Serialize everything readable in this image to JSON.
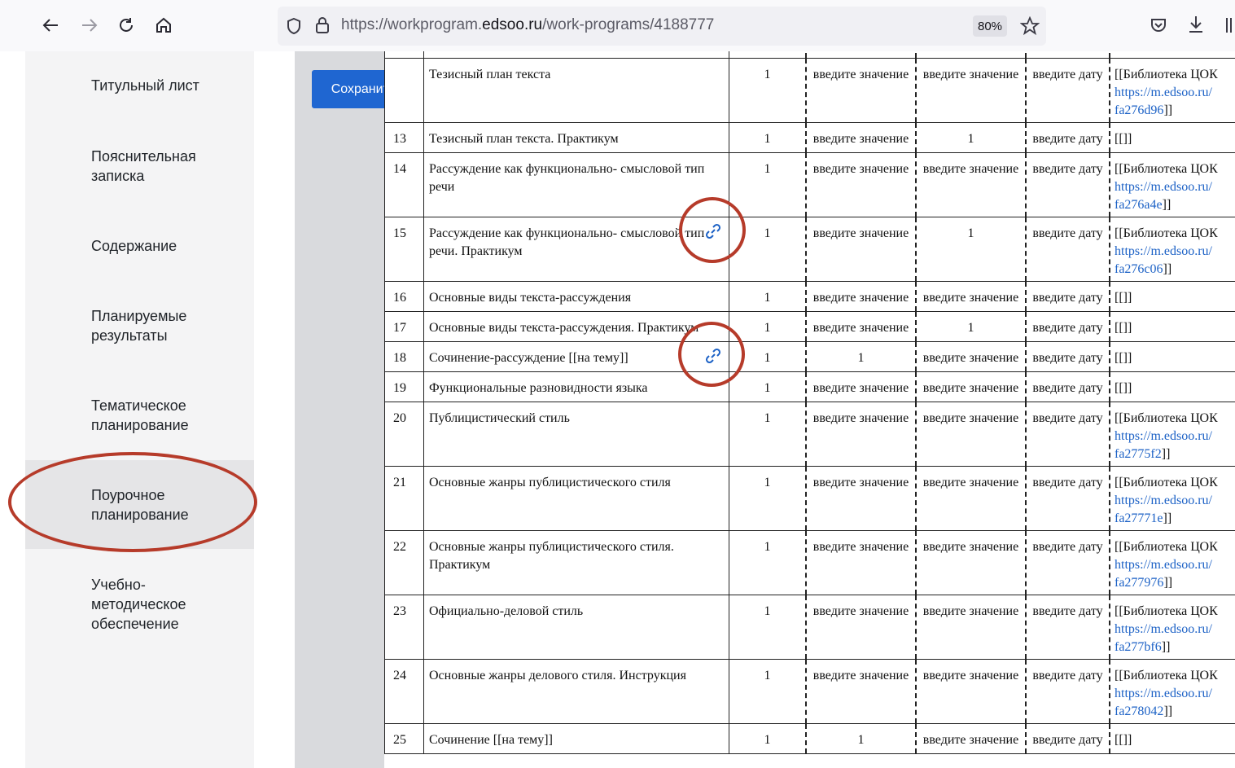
{
  "browser": {
    "url_prefix": "https://workprogram.",
    "url_host": "edsoo.ru",
    "url_path": "/work-programs/4188777",
    "zoom": "80%",
    "icons": [
      "back-arrow-icon",
      "forward-arrow-icon",
      "reload-icon",
      "home-icon",
      "shield-icon",
      "lock-icon",
      "star-icon",
      "pocket-icon",
      "download-icon",
      "library-icon"
    ]
  },
  "sidebar": {
    "items": [
      {
        "label": "Титульный лист"
      },
      {
        "label": "Пояснительная записка"
      },
      {
        "label": "Содержание"
      },
      {
        "label": "Планируемые результаты"
      },
      {
        "label": "Тематическое планирование"
      },
      {
        "label": "Поурочное планирование"
      },
      {
        "label": "Учебно-методическое обеспечение"
      }
    ],
    "active_index": 5
  },
  "save_button": "Сохранить",
  "table": {
    "placeholder_value": "введите значение",
    "placeholder_date": "введите дату",
    "rows": [
      {
        "num": "",
        "topic": "Тезисный план текста",
        "hours": "1",
        "control": "введите значение",
        "practical": "введите значение",
        "date": "введите дату",
        "res_prefix": "[[Библиотека ЦОК ",
        "res_link": "https://m.edsoo.ru/fa276d96",
        "res_suffix": "]]"
      },
      {
        "num": "13",
        "topic": "Тезисный план текста. Практикум",
        "hours": "1",
        "control": "введите значение",
        "practical": "1",
        "date": "введите дату",
        "res_prefix": "[[]]",
        "res_link": "",
        "res_suffix": ""
      },
      {
        "num": "14",
        "topic": "Рассуждение как функционально- смысловой тип речи",
        "hours": "1",
        "control": "введите значение",
        "practical": "введите значение",
        "date": "введите дату",
        "res_prefix": "[[Библиотека ЦОК ",
        "res_link": "https://m.edsoo.ru/fa276a4e",
        "res_suffix": "]]"
      },
      {
        "num": "15",
        "topic": "Рассуждение как функционально- смысловой тип речи. Практикум",
        "hours": "1",
        "control": "введите значение",
        "practical": "1",
        "date": "введите дату",
        "res_prefix": "[[Библиотека ЦОК ",
        "res_link": "https://m.edsoo.ru/fa276c06",
        "res_suffix": "]]"
      },
      {
        "num": "16",
        "topic": "Основные виды текста-рассуждения",
        "hours": "1",
        "control": "введите значение",
        "practical": "введите значение",
        "date": "введите дату",
        "res_prefix": "[[]]",
        "res_link": "",
        "res_suffix": ""
      },
      {
        "num": "17",
        "topic": "Основные виды текста-рассуждения. Практикум",
        "hours": "1",
        "control": "введите значение",
        "practical": "1",
        "date": "введите дату",
        "res_prefix": "[[]]",
        "res_link": "",
        "res_suffix": ""
      },
      {
        "num": "18",
        "topic": "Сочинение-рассуждение [[на тему]]",
        "hours": "1",
        "control": "1",
        "practical": "введите значение",
        "date": "введите дату",
        "res_prefix": "[[]]",
        "res_link": "",
        "res_suffix": ""
      },
      {
        "num": "19",
        "topic": "Функциональные разновидности языка",
        "hours": "1",
        "control": "введите значение",
        "practical": "введите значение",
        "date": "введите дату",
        "res_prefix": "[[]]",
        "res_link": "",
        "res_suffix": ""
      },
      {
        "num": "20",
        "topic": "Публицистический стиль",
        "hours": "1",
        "control": "введите значение",
        "practical": "введите значение",
        "date": "введите дату",
        "res_prefix": "[[Библиотека ЦОК ",
        "res_link": "https://m.edsoo.ru/fa2775f2",
        "res_suffix": "]]"
      },
      {
        "num": "21",
        "topic": "Основные жанры публицистического стиля",
        "hours": "1",
        "control": "введите значение",
        "practical": "введите значение",
        "date": "введите дату",
        "res_prefix": "[[Библиотека ЦОК ",
        "res_link": "https://m.edsoo.ru/fa27771e",
        "res_suffix": "]]"
      },
      {
        "num": "22",
        "topic": "Основные жанры публицистического стиля. Практикум",
        "hours": "1",
        "control": "введите значение",
        "practical": "введите значение",
        "date": "введите дату",
        "res_prefix": "[[Библиотека ЦОК ",
        "res_link": "https://m.edsoo.ru/fa277976",
        "res_suffix": "]]"
      },
      {
        "num": "23",
        "topic": "Официально-деловой стиль",
        "hours": "1",
        "control": "введите значение",
        "practical": "введите значение",
        "date": "введите дату",
        "res_prefix": "[[Библиотека ЦОК ",
        "res_link": "https://m.edsoo.ru/fa277bf6",
        "res_suffix": "]]"
      },
      {
        "num": "24",
        "topic": "Основные жанры делового стиля. Инструкция",
        "hours": "1",
        "control": "введите значение",
        "practical": "введите значение",
        "date": "введите дату",
        "res_prefix": "[[Библиотека ЦОК ",
        "res_link": "https://m.edsoo.ru/fa278042",
        "res_suffix": "]]"
      },
      {
        "num": "25",
        "topic": "Сочинение [[на тему]]",
        "hours": "1",
        "control": "1",
        "practical": "введите значение",
        "date": "введите дату",
        "res_prefix": "[[]]",
        "res_link": "",
        "res_suffix": ""
      }
    ]
  }
}
